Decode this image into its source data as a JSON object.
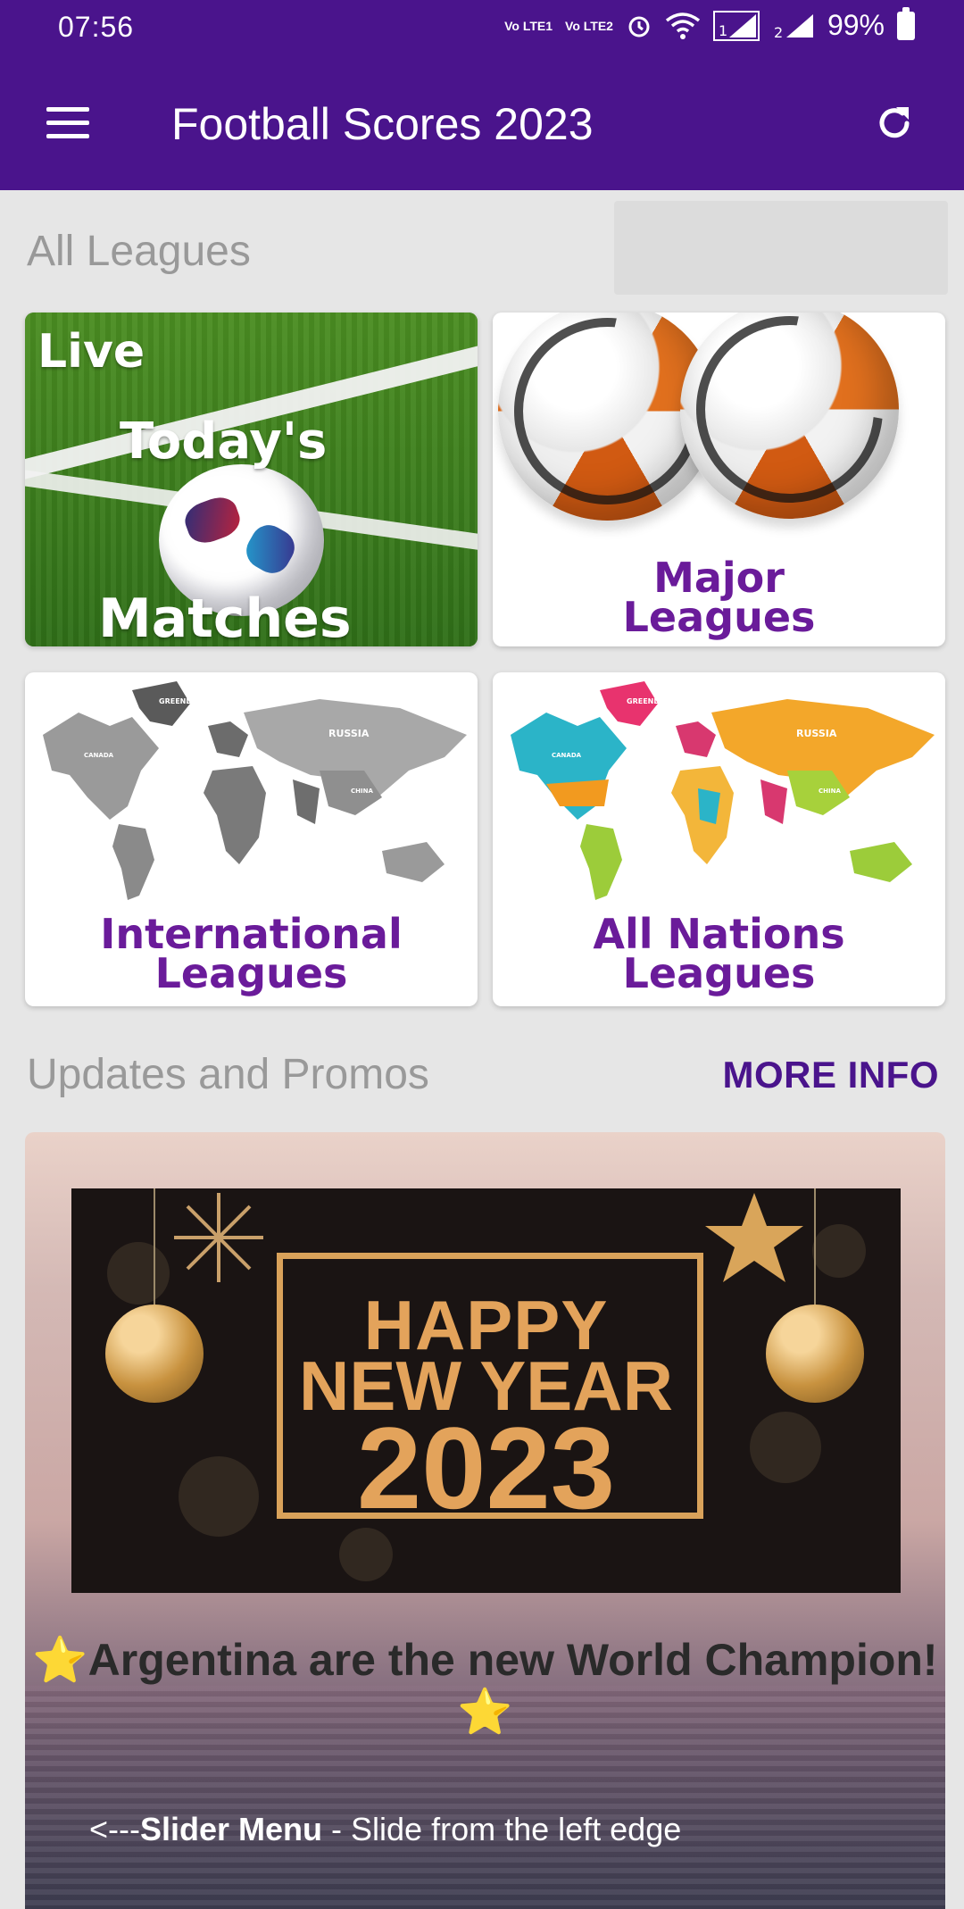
{
  "status_bar": {
    "time": "07:56",
    "sim1": "Vo LTE1",
    "sim2": "Vo LTE2",
    "battery_percent": "99%"
  },
  "app_bar": {
    "title": "Football Scores 2023",
    "menu_icon": "hamburger-menu-icon",
    "refresh_icon": "refresh-icon"
  },
  "leagues_section": {
    "title": "All Leagues",
    "tiles": [
      {
        "id": "today",
        "lines": [
          "Live",
          "Today's",
          "Matches"
        ]
      },
      {
        "id": "major",
        "lines": [
          "Major",
          "Leagues"
        ]
      },
      {
        "id": "international",
        "lines": [
          "International",
          "Leagues"
        ]
      },
      {
        "id": "nations",
        "lines": [
          "All Nations",
          "Leagues"
        ]
      }
    ],
    "map_country_labels": [
      "GREENLAND",
      "RUSSIA",
      "CANADA",
      "CHINA"
    ]
  },
  "promos_section": {
    "title": "Updates and Promos",
    "more_info_label": "MORE INFO",
    "banner": {
      "line1": "HAPPY",
      "line2": "NEW YEAR",
      "line3": "2023",
      "announcement": "Argentina are the new World Champion!",
      "star": "⭐",
      "slider_hint_prefix": "<---",
      "slider_hint_bold": "Slider Menu",
      "slider_hint_rest": " - Slide from the left edge"
    }
  },
  "colors": {
    "primary": "#4a148c",
    "tile_label": "#6a1b9a",
    "background": "#e6e6e6"
  }
}
